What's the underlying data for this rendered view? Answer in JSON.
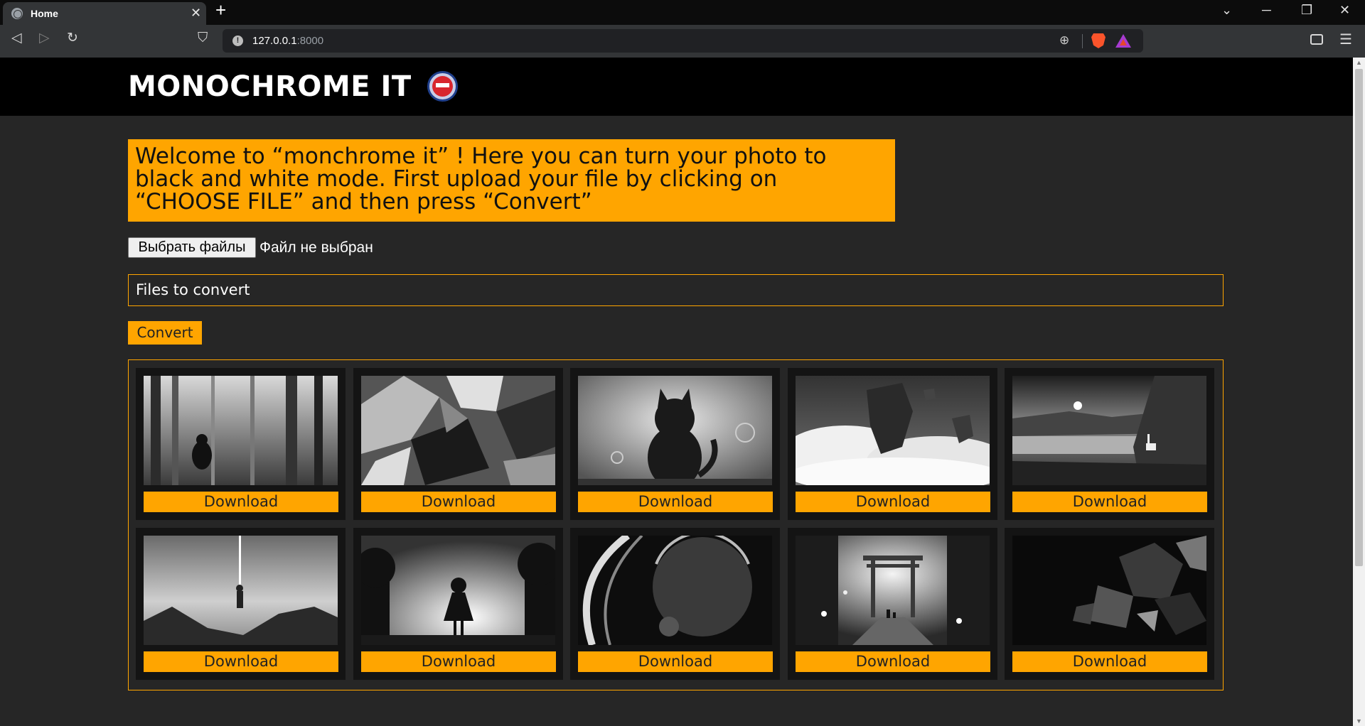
{
  "browser": {
    "tab_title": "Home",
    "tab_close": "✕",
    "new_tab": "+",
    "url_host": "127.0.0.1",
    "url_port": ":8000",
    "win_minimize": "─",
    "win_restore": "❐",
    "win_close": "✕",
    "tab_search": "⌄"
  },
  "header": {
    "title": "MONOCHROME IT"
  },
  "main": {
    "welcome_text": "Welcome to “monchrome it” ! Here you can turn your photo to black and white mode. First upload your file by clicking on “CHOOSE FILE” and then press “Convert”",
    "choose_file_label": "Выбрать файлы",
    "file_status": "Файл не выбран",
    "files_to_convert": "Files to convert",
    "convert_label": "Convert"
  },
  "gallery": {
    "download_label": "Download",
    "items": [
      {
        "icon": "forest-figure-image"
      },
      {
        "icon": "shattered-fragments-image"
      },
      {
        "icon": "cat-silhouette-image"
      },
      {
        "icon": "floating-rock-image"
      },
      {
        "icon": "lake-deer-image"
      },
      {
        "icon": "falling-figure-image"
      },
      {
        "icon": "girl-silhouette-image"
      },
      {
        "icon": "planet-space-image"
      },
      {
        "icon": "torii-gate-image"
      },
      {
        "icon": "dark-shards-image"
      }
    ]
  },
  "colors": {
    "accent": "#ffa500",
    "page_bg": "#262626",
    "header_bg": "#000000",
    "card_bg": "#141414"
  }
}
